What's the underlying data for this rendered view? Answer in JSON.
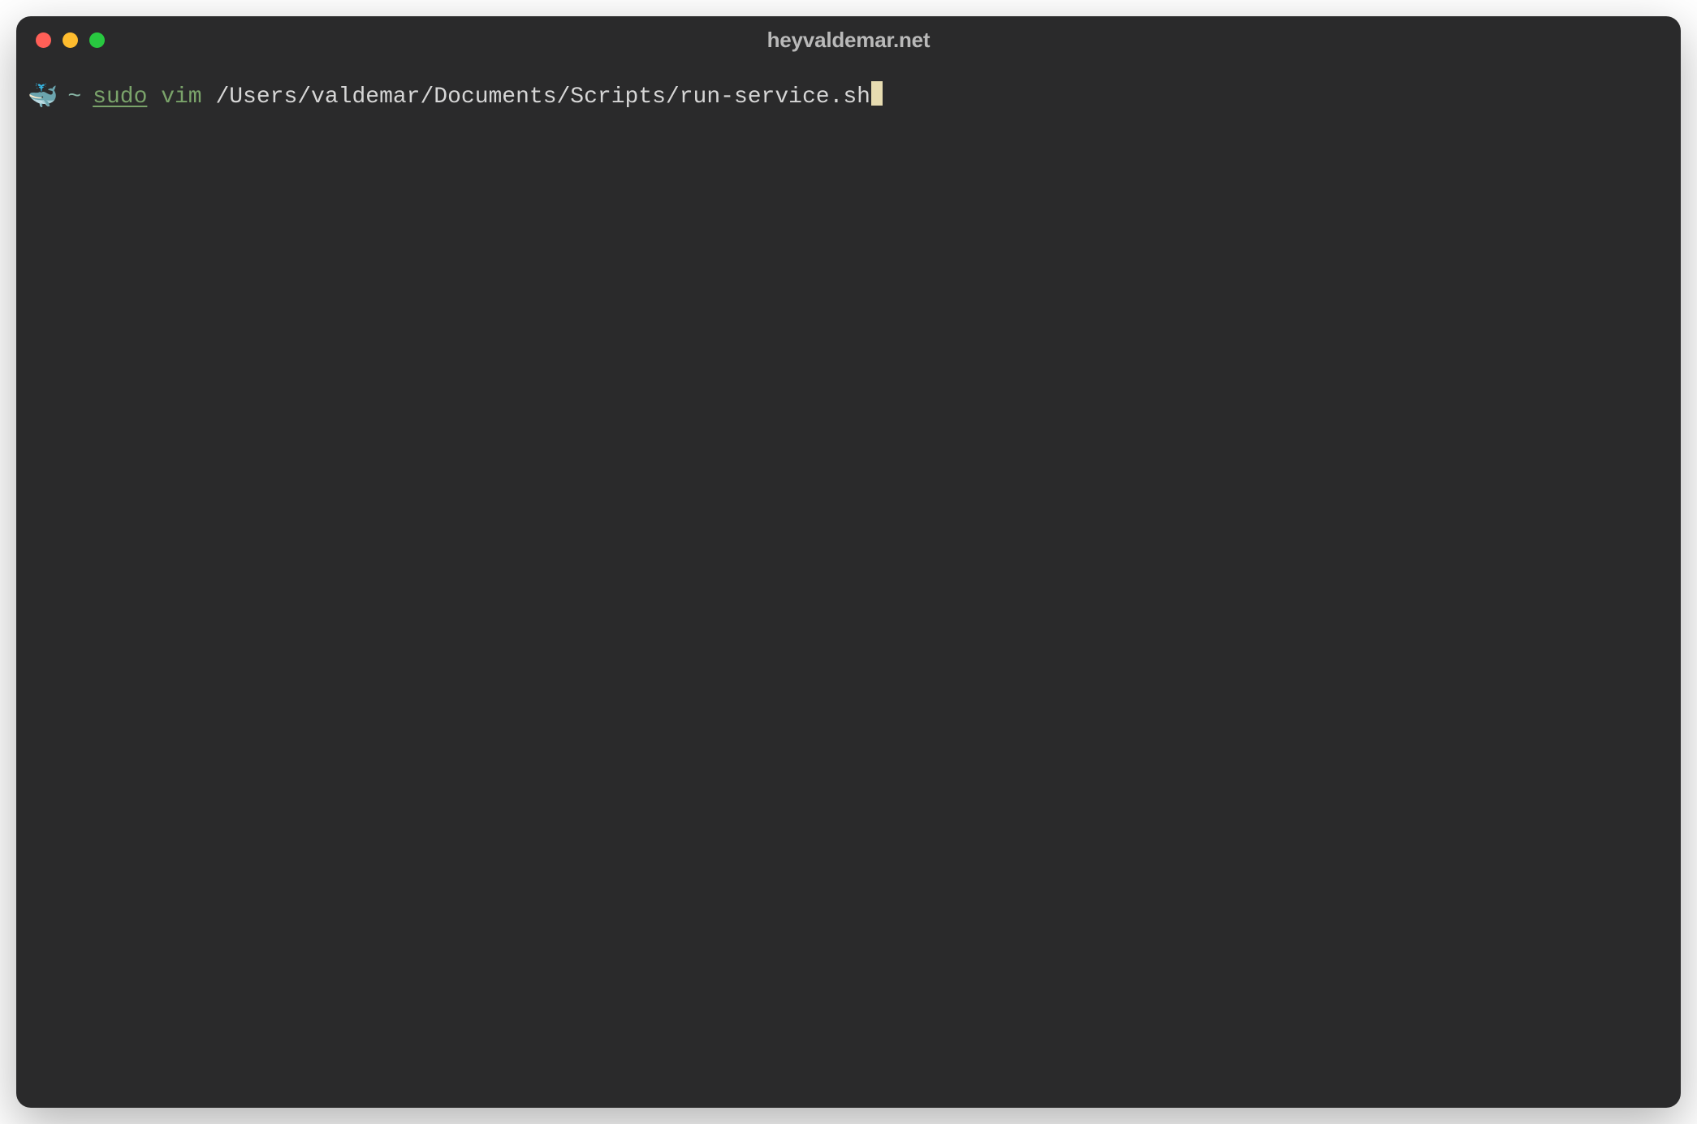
{
  "window": {
    "title": "heyvaldemar.net"
  },
  "prompt": {
    "icon": "🐳",
    "symbol": "~",
    "command_sudo": "sudo",
    "command_editor": "vim",
    "command_path": "/Users/valdemar/Documents/Scripts/run-service.sh"
  },
  "colors": {
    "background": "#2a2a2b",
    "close": "#ff5f57",
    "minimize": "#febc2e",
    "maximize": "#28c840",
    "title_text": "#b9b9b9",
    "prompt_green": "#7aa36a",
    "path_text": "#d6d6d6",
    "cursor": "#e7dcb1"
  }
}
